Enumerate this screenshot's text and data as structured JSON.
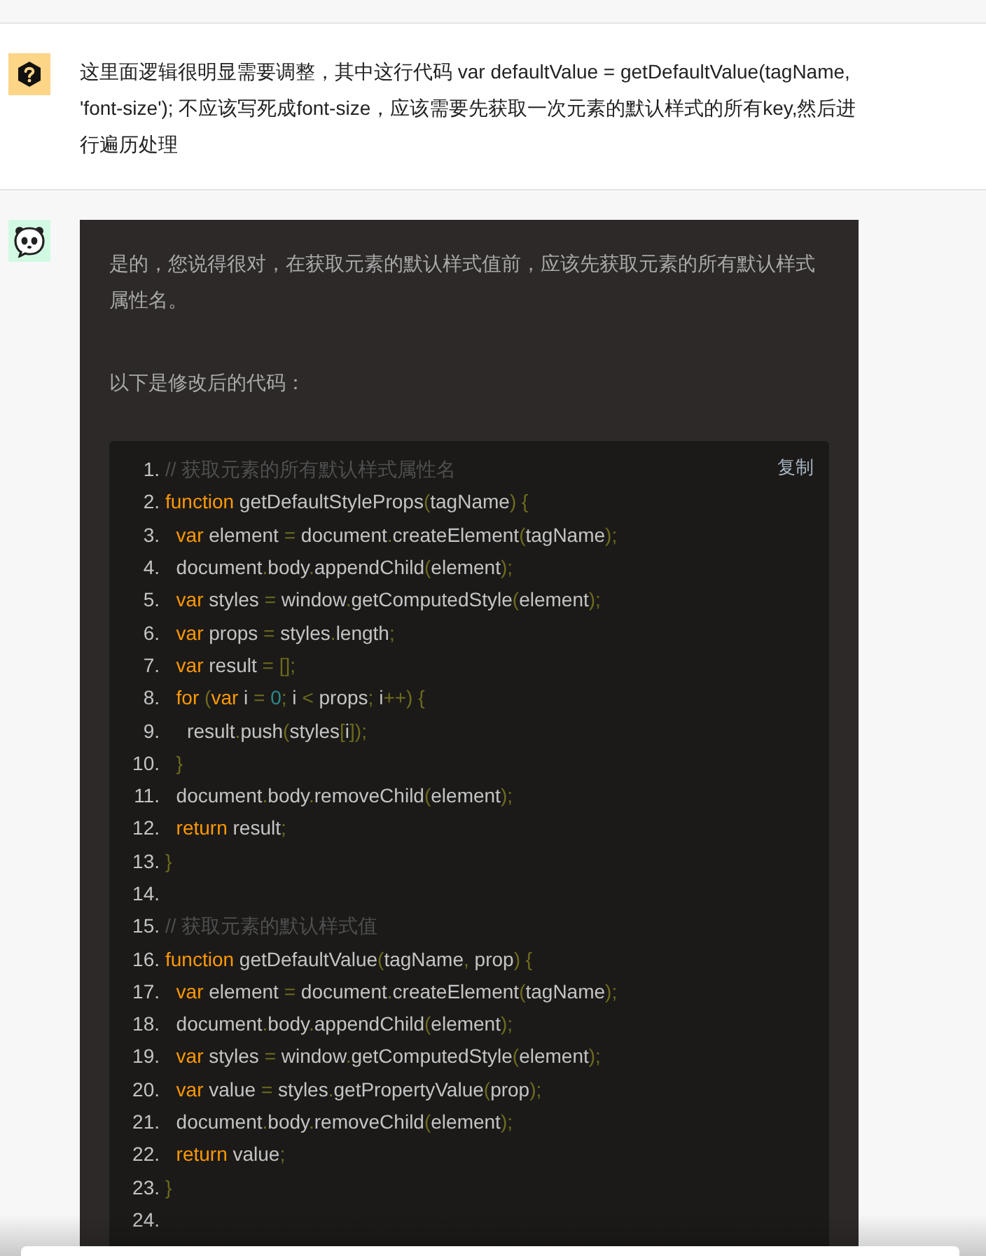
{
  "question": {
    "text": "这里面逻辑很明显需要调整，其中这行代码  var defaultValue = getDefaultValue(tagName, 'font-size'); 不应该写死成font-size，应该需要先获取一次元素的默认样式的所有key,然后进行遍历处理"
  },
  "answer": {
    "paragraphs": [
      "是的，您说得很对，在获取元素的默认样式值前，应该先获取元素的所有默认样式属性名。",
      "以下是修改后的代码："
    ],
    "code": {
      "copy_label": "复制",
      "lines": [
        {
          "number": "1.",
          "tokens": [
            {
              "kind": "comment",
              "text": "// 获取元素的所有默认样式属性名"
            }
          ]
        },
        {
          "number": "2.",
          "tokens": [
            {
              "kind": "keyword",
              "text": "function"
            },
            {
              "kind": "plain",
              "text": " getDefaultStyleProps"
            },
            {
              "kind": "punct",
              "text": "("
            },
            {
              "kind": "plain",
              "text": "tagName"
            },
            {
              "kind": "punct",
              "text": ") {"
            }
          ]
        },
        {
          "number": "3.",
          "tokens": [
            {
              "kind": "keyword",
              "text": "  var"
            },
            {
              "kind": "plain",
              "text": " element "
            },
            {
              "kind": "punct",
              "text": "="
            },
            {
              "kind": "plain",
              "text": " document"
            },
            {
              "kind": "punct",
              "text": "."
            },
            {
              "kind": "plain",
              "text": "createElement"
            },
            {
              "kind": "punct",
              "text": "("
            },
            {
              "kind": "plain",
              "text": "tagName"
            },
            {
              "kind": "punct",
              "text": ");"
            }
          ]
        },
        {
          "number": "4.",
          "tokens": [
            {
              "kind": "plain",
              "text": "  document"
            },
            {
              "kind": "punct",
              "text": "."
            },
            {
              "kind": "plain",
              "text": "body"
            },
            {
              "kind": "punct",
              "text": "."
            },
            {
              "kind": "plain",
              "text": "appendChild"
            },
            {
              "kind": "punct",
              "text": "("
            },
            {
              "kind": "plain",
              "text": "element"
            },
            {
              "kind": "punct",
              "text": ");"
            }
          ]
        },
        {
          "number": "5.",
          "tokens": [
            {
              "kind": "keyword",
              "text": "  var"
            },
            {
              "kind": "plain",
              "text": " styles "
            },
            {
              "kind": "punct",
              "text": "="
            },
            {
              "kind": "plain",
              "text": " window"
            },
            {
              "kind": "punct",
              "text": "."
            },
            {
              "kind": "plain",
              "text": "getComputedStyle"
            },
            {
              "kind": "punct",
              "text": "("
            },
            {
              "kind": "plain",
              "text": "element"
            },
            {
              "kind": "punct",
              "text": ");"
            }
          ]
        },
        {
          "number": "6.",
          "tokens": [
            {
              "kind": "keyword",
              "text": "  var"
            },
            {
              "kind": "plain",
              "text": " props "
            },
            {
              "kind": "punct",
              "text": "="
            },
            {
              "kind": "plain",
              "text": " styles"
            },
            {
              "kind": "punct",
              "text": "."
            },
            {
              "kind": "plain",
              "text": "length"
            },
            {
              "kind": "punct",
              "text": ";"
            }
          ]
        },
        {
          "number": "7.",
          "tokens": [
            {
              "kind": "keyword",
              "text": "  var"
            },
            {
              "kind": "plain",
              "text": " result "
            },
            {
              "kind": "punct",
              "text": "= [];"
            }
          ]
        },
        {
          "number": "8.",
          "tokens": [
            {
              "kind": "keyword",
              "text": "  for"
            },
            {
              "kind": "punct",
              "text": " ("
            },
            {
              "kind": "keyword",
              "text": "var"
            },
            {
              "kind": "plain",
              "text": " i "
            },
            {
              "kind": "punct",
              "text": "= "
            },
            {
              "kind": "number",
              "text": "0"
            },
            {
              "kind": "punct",
              "text": ";"
            },
            {
              "kind": "plain",
              "text": " i "
            },
            {
              "kind": "punct",
              "text": "<"
            },
            {
              "kind": "plain",
              "text": " props"
            },
            {
              "kind": "punct",
              "text": ";"
            },
            {
              "kind": "plain",
              "text": " i"
            },
            {
              "kind": "punct",
              "text": "++) {"
            }
          ]
        },
        {
          "number": "9.",
          "tokens": [
            {
              "kind": "plain",
              "text": "    result"
            },
            {
              "kind": "punct",
              "text": "."
            },
            {
              "kind": "plain",
              "text": "push"
            },
            {
              "kind": "punct",
              "text": "("
            },
            {
              "kind": "plain",
              "text": "styles"
            },
            {
              "kind": "punct",
              "text": "["
            },
            {
              "kind": "plain",
              "text": "i"
            },
            {
              "kind": "punct",
              "text": "]);"
            }
          ]
        },
        {
          "number": "10.",
          "tokens": [
            {
              "kind": "punct",
              "text": "  }"
            }
          ]
        },
        {
          "number": "11.",
          "tokens": [
            {
              "kind": "plain",
              "text": "  document"
            },
            {
              "kind": "punct",
              "text": "."
            },
            {
              "kind": "plain",
              "text": "body"
            },
            {
              "kind": "punct",
              "text": "."
            },
            {
              "kind": "plain",
              "text": "removeChild"
            },
            {
              "kind": "punct",
              "text": "("
            },
            {
              "kind": "plain",
              "text": "element"
            },
            {
              "kind": "punct",
              "text": ");"
            }
          ]
        },
        {
          "number": "12.",
          "tokens": [
            {
              "kind": "keyword",
              "text": "  return"
            },
            {
              "kind": "plain",
              "text": " result"
            },
            {
              "kind": "punct",
              "text": ";"
            }
          ]
        },
        {
          "number": "13.",
          "tokens": [
            {
              "kind": "punct",
              "text": "}"
            }
          ]
        },
        {
          "number": "14."
        },
        {
          "number": "15.",
          "tokens": [
            {
              "kind": "comment",
              "text": "// 获取元素的默认样式值"
            }
          ]
        },
        {
          "number": "16.",
          "tokens": [
            {
              "kind": "keyword",
              "text": "function"
            },
            {
              "kind": "plain",
              "text": " getDefaultValue"
            },
            {
              "kind": "punct",
              "text": "("
            },
            {
              "kind": "plain",
              "text": "tagName"
            },
            {
              "kind": "punct",
              "text": ", "
            },
            {
              "kind": "plain",
              "text": "prop"
            },
            {
              "kind": "punct",
              "text": ") {"
            }
          ]
        },
        {
          "number": "17.",
          "tokens": [
            {
              "kind": "keyword",
              "text": "  var"
            },
            {
              "kind": "plain",
              "text": " element "
            },
            {
              "kind": "punct",
              "text": "="
            },
            {
              "kind": "plain",
              "text": " document"
            },
            {
              "kind": "punct",
              "text": "."
            },
            {
              "kind": "plain",
              "text": "createElement"
            },
            {
              "kind": "punct",
              "text": "("
            },
            {
              "kind": "plain",
              "text": "tagName"
            },
            {
              "kind": "punct",
              "text": ");"
            }
          ]
        },
        {
          "number": "18.",
          "tokens": [
            {
              "kind": "plain",
              "text": "  document"
            },
            {
              "kind": "punct",
              "text": "."
            },
            {
              "kind": "plain",
              "text": "body"
            },
            {
              "kind": "punct",
              "text": "."
            },
            {
              "kind": "plain",
              "text": "appendChild"
            },
            {
              "kind": "punct",
              "text": "("
            },
            {
              "kind": "plain",
              "text": "element"
            },
            {
              "kind": "punct",
              "text": ");"
            }
          ]
        },
        {
          "number": "19.",
          "tokens": [
            {
              "kind": "keyword",
              "text": "  var"
            },
            {
              "kind": "plain",
              "text": " styles "
            },
            {
              "kind": "punct",
              "text": "="
            },
            {
              "kind": "plain",
              "text": " window"
            },
            {
              "kind": "punct",
              "text": "."
            },
            {
              "kind": "plain",
              "text": "getComputedStyle"
            },
            {
              "kind": "punct",
              "text": "("
            },
            {
              "kind": "plain",
              "text": "element"
            },
            {
              "kind": "punct",
              "text": ");"
            }
          ]
        },
        {
          "number": "20.",
          "tokens": [
            {
              "kind": "keyword",
              "text": "  var"
            },
            {
              "kind": "plain",
              "text": " value "
            },
            {
              "kind": "punct",
              "text": "="
            },
            {
              "kind": "plain",
              "text": " styles"
            },
            {
              "kind": "punct",
              "text": "."
            },
            {
              "kind": "plain",
              "text": "getPropertyValue"
            },
            {
              "kind": "punct",
              "text": "("
            },
            {
              "kind": "plain",
              "text": "prop"
            },
            {
              "kind": "punct",
              "text": ");"
            }
          ]
        },
        {
          "number": "21.",
          "tokens": [
            {
              "kind": "plain",
              "text": "  document"
            },
            {
              "kind": "punct",
              "text": "."
            },
            {
              "kind": "plain",
              "text": "body"
            },
            {
              "kind": "punct",
              "text": "."
            },
            {
              "kind": "plain",
              "text": "removeChild"
            },
            {
              "kind": "punct",
              "text": "("
            },
            {
              "kind": "plain",
              "text": "element"
            },
            {
              "kind": "punct",
              "text": ");"
            }
          ]
        },
        {
          "number": "22.",
          "tokens": [
            {
              "kind": "keyword",
              "text": "  return"
            },
            {
              "kind": "plain",
              "text": " value"
            },
            {
              "kind": "punct",
              "text": ";"
            }
          ]
        },
        {
          "number": "23.",
          "tokens": [
            {
              "kind": "punct",
              "text": "}"
            }
          ]
        },
        {
          "number": "24."
        }
      ]
    }
  }
}
